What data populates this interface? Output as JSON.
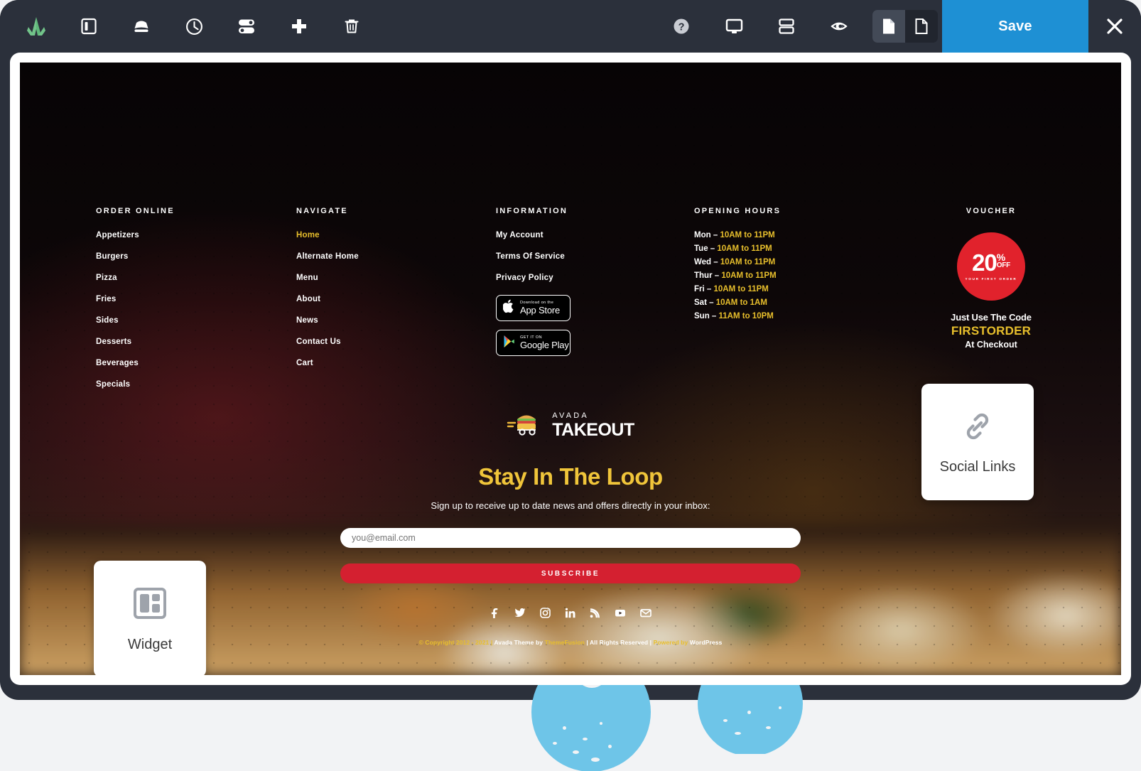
{
  "toolbar": {
    "left_icons": [
      {
        "name": "avada-logo-icon",
        "label": "Avada"
      },
      {
        "name": "panel-toggle-icon",
        "label": "Toggle Sidebar"
      },
      {
        "name": "save-library-icon",
        "label": "Library"
      },
      {
        "name": "history-icon",
        "label": "History"
      },
      {
        "name": "settings-sliders-icon",
        "label": "Page Options"
      },
      {
        "name": "add-icon",
        "label": "Add Element"
      },
      {
        "name": "trash-icon",
        "label": "Delete"
      }
    ],
    "right_icons": [
      {
        "name": "help-icon",
        "label": "Help"
      },
      {
        "name": "responsive-desktop-icon",
        "label": "Responsive View"
      },
      {
        "name": "layout-rows-icon",
        "label": "Layout"
      },
      {
        "name": "preview-eye-icon",
        "label": "Preview"
      }
    ],
    "view_toggle": [
      {
        "name": "page-view-icon",
        "label": "Page View",
        "active": true
      },
      {
        "name": "template-view-icon",
        "label": "Template View",
        "active": false
      }
    ],
    "save_label": "Save",
    "close_label": "×",
    "accent_color": "#1e90d4",
    "bar_color": "#2b303b"
  },
  "footer": {
    "columns": [
      {
        "title": "ORDER ONLINE",
        "links": [
          "Appetizers",
          "Burgers",
          "Pizza",
          "Fries",
          "Sides",
          "Desserts",
          "Beverages",
          "Specials"
        ]
      },
      {
        "title": "NAVIGATE",
        "links": [
          "Home",
          "Alternate Home",
          "Menu",
          "About",
          "News",
          "Contact Us",
          "Cart"
        ],
        "active_index": 0
      },
      {
        "title": "INFORMATION",
        "links": [
          "My Account",
          "Terms Of Service",
          "Privacy Policy"
        ]
      }
    ],
    "app_badges": [
      {
        "name": "app-store-badge",
        "small": "Download on the",
        "big": "App Store",
        "icon": "apple-icon"
      },
      {
        "name": "google-play-badge",
        "small": "GET IT ON",
        "big": "Google Play",
        "icon": "play-icon"
      }
    ],
    "hours": {
      "title": "OPENING HOURS",
      "rows": [
        {
          "day": "Mon –",
          "value": "10AM to 11PM"
        },
        {
          "day": "Tue –",
          "value": "10AM to 11PM"
        },
        {
          "day": "Wed –",
          "value": "10AM to 11PM"
        },
        {
          "day": "Thur –",
          "value": "10AM to 11PM"
        },
        {
          "day": "Fri –",
          "value": "10AM to 11PM"
        },
        {
          "day": "Sat –",
          "value": "10AM to 1AM"
        },
        {
          "day": "Sun –",
          "value": "11AM to 10PM"
        }
      ]
    },
    "voucher": {
      "title": "VOUCHER",
      "amount": "20",
      "percent": "%",
      "off": "OFF",
      "sub": "YOUR FIRST ORDER",
      "line1": "Just Use The Code",
      "code": "FIRSTORDER",
      "line3": "At Checkout",
      "badge_color": "#e1222c"
    },
    "brand": {
      "top": "AVADA",
      "bottom": "TAKEOUT"
    },
    "newsletter": {
      "heading": "Stay In The Loop",
      "subheading": "Sign up to receive up to date news and offers directly in your inbox:",
      "email_placeholder": "you@email.com",
      "email_value": "",
      "subscribe_label": "SUBSCRIBE",
      "button_color": "#d42030",
      "heading_color": "#f0c53a"
    },
    "social": [
      {
        "name": "facebook-icon",
        "label": "Facebook"
      },
      {
        "name": "twitter-icon",
        "label": "Twitter"
      },
      {
        "name": "instagram-icon",
        "label": "Instagram"
      },
      {
        "name": "linkedin-icon",
        "label": "LinkedIn"
      },
      {
        "name": "rss-icon",
        "label": "RSS"
      },
      {
        "name": "youtube-icon",
        "label": "YouTube"
      },
      {
        "name": "email-icon",
        "label": "Email"
      }
    ],
    "copyright": {
      "part1": "© Copyright 2012 - 2021 | ",
      "white1": "Avada Theme by ",
      "part2": "ThemeFusion",
      "white2": " | All Rights Reserved | ",
      "part3": "Powered by ",
      "white3": "WordPress"
    }
  },
  "element_cards": [
    {
      "name": "widget-element-card",
      "label": "Widget",
      "icon": "widget-layout-icon"
    },
    {
      "name": "social-links-element-card",
      "label": "Social Links",
      "icon": "link-chain-icon"
    }
  ]
}
